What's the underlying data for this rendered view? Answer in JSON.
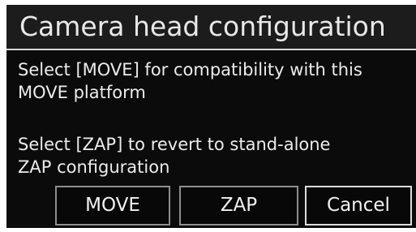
{
  "dialog": {
    "title": "Camera head configuration",
    "message1": {
      "line1": "Select [MOVE] for compatibility with this",
      "line2": "MOVE platform"
    },
    "message2": {
      "line1": "Select [ZAP] to revert to stand-alone",
      "line2": "ZAP configuration"
    },
    "buttons": {
      "move": "MOVE",
      "zap": "ZAP",
      "cancel": "Cancel"
    }
  }
}
